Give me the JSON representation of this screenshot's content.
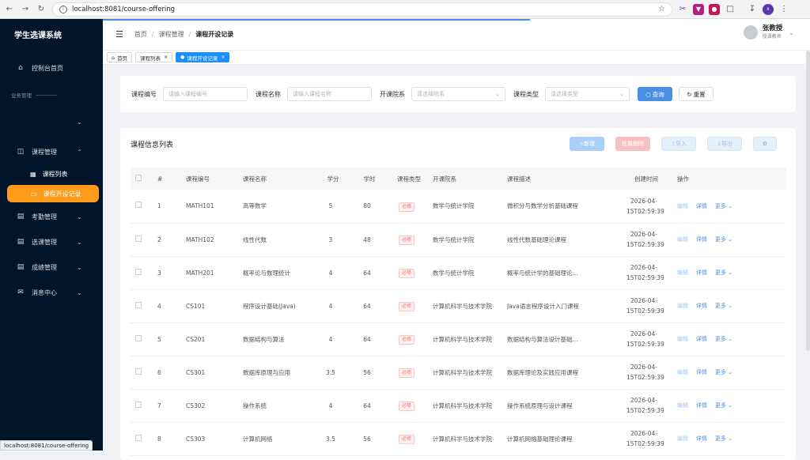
{
  "browser": {
    "url": "localhost:8081/course-offering",
    "status_url": "localhost:8081/course-offering"
  },
  "sidebar": {
    "title": "学生选课系统",
    "dashboard": "控制台首页",
    "section_label": "业务管理",
    "course_mgmt": "课程管理",
    "course_list": "课程列表",
    "course_offering": "课程开设记录",
    "attendance": "考勤管理",
    "selection": "选课管理",
    "grades": "成绩管理",
    "messages": "消息中心"
  },
  "header": {
    "breadcrumb": [
      "首页",
      "课程管理",
      "课程开设记录"
    ],
    "user_name": "张教授",
    "user_role": "授课教师"
  },
  "tabs": [
    {
      "label": "首页"
    },
    {
      "label": "课程列表"
    },
    {
      "label": "课程开设记录"
    }
  ],
  "filter": {
    "code_label": "课程编号",
    "code_placeholder": "请输入课程编号",
    "name_label": "课程名称",
    "name_placeholder": "请输入课程名称",
    "college_label": "开课院系",
    "college_placeholder": "请选择院系",
    "type_label": "课程类型",
    "type_placeholder": "请选择类型",
    "query_btn": "查询",
    "reset_btn": "重置"
  },
  "list": {
    "title": "课程信息列表",
    "add_btn": "新增",
    "delete_btn": "批量删除",
    "import_btn": "导入",
    "export_btn": "导出",
    "columns": [
      "#",
      "课程编号",
      "课程名称",
      "学分",
      "学时",
      "课程类型",
      "开课院系",
      "课程描述",
      "创建时间",
      "操作"
    ],
    "actions": {
      "edit": "编辑",
      "detail": "详情",
      "more": "更多"
    },
    "rows": [
      {
        "idx": "1",
        "code": "MATH101",
        "name": "高等数学",
        "credit": "5",
        "hours": "80",
        "type": "必修",
        "college": "数学与统计学院",
        "desc": "微积分与数学分析基础课程",
        "created": "2026-04-15T02:59:39"
      },
      {
        "idx": "2",
        "code": "MATH102",
        "name": "线性代数",
        "credit": "3",
        "hours": "48",
        "type": "必修",
        "college": "数学与统计学院",
        "desc": "线性代数基础理论课程",
        "created": "2026-04-15T02:59:39"
      },
      {
        "idx": "3",
        "code": "MATH201",
        "name": "概率论与数理统计",
        "credit": "4",
        "hours": "64",
        "type": "必修",
        "college": "数学与统计学院",
        "desc": "概率与统计学的基础理论...",
        "created": "2026-04-15T02:59:39"
      },
      {
        "idx": "4",
        "code": "CS101",
        "name": "程序设计基础(Java)",
        "credit": "4",
        "hours": "64",
        "type": "必修",
        "college": "计算机科学与技术学院",
        "desc": "Java语言程序设计入门课程",
        "created": "2026-04-15T02:59:39"
      },
      {
        "idx": "5",
        "code": "CS201",
        "name": "数据结构与算法",
        "credit": "4",
        "hours": "64",
        "type": "必修",
        "college": "计算机科学与技术学院",
        "desc": "数据结构与算法设计基础...",
        "created": "2026-04-15T02:59:39"
      },
      {
        "idx": "6",
        "code": "CS301",
        "name": "数据库原理与应用",
        "credit": "3.5",
        "hours": "56",
        "type": "必修",
        "college": "计算机科学与技术学院",
        "desc": "数据库理论及实践应用课程",
        "created": "2026-04-15T02:59:39"
      },
      {
        "idx": "7",
        "code": "CS302",
        "name": "操作系统",
        "credit": "4",
        "hours": "64",
        "type": "必修",
        "college": "计算机科学与技术学院",
        "desc": "操作系统原理与设计课程",
        "created": "2026-04-15T02:59:39"
      },
      {
        "idx": "8",
        "code": "CS303",
        "name": "计算机网络",
        "credit": "3.5",
        "hours": "56",
        "type": "必修",
        "college": "计算机科学与技术学院",
        "desc": "计算机网络基础理论课程",
        "created": "2026-04-15T02:59:39"
      }
    ]
  },
  "colors": {
    "accent": "#4a90e2",
    "sidebar_bg": "#001529",
    "active_menu": "#ff9a1a",
    "tag_required": "#f56c6c"
  }
}
